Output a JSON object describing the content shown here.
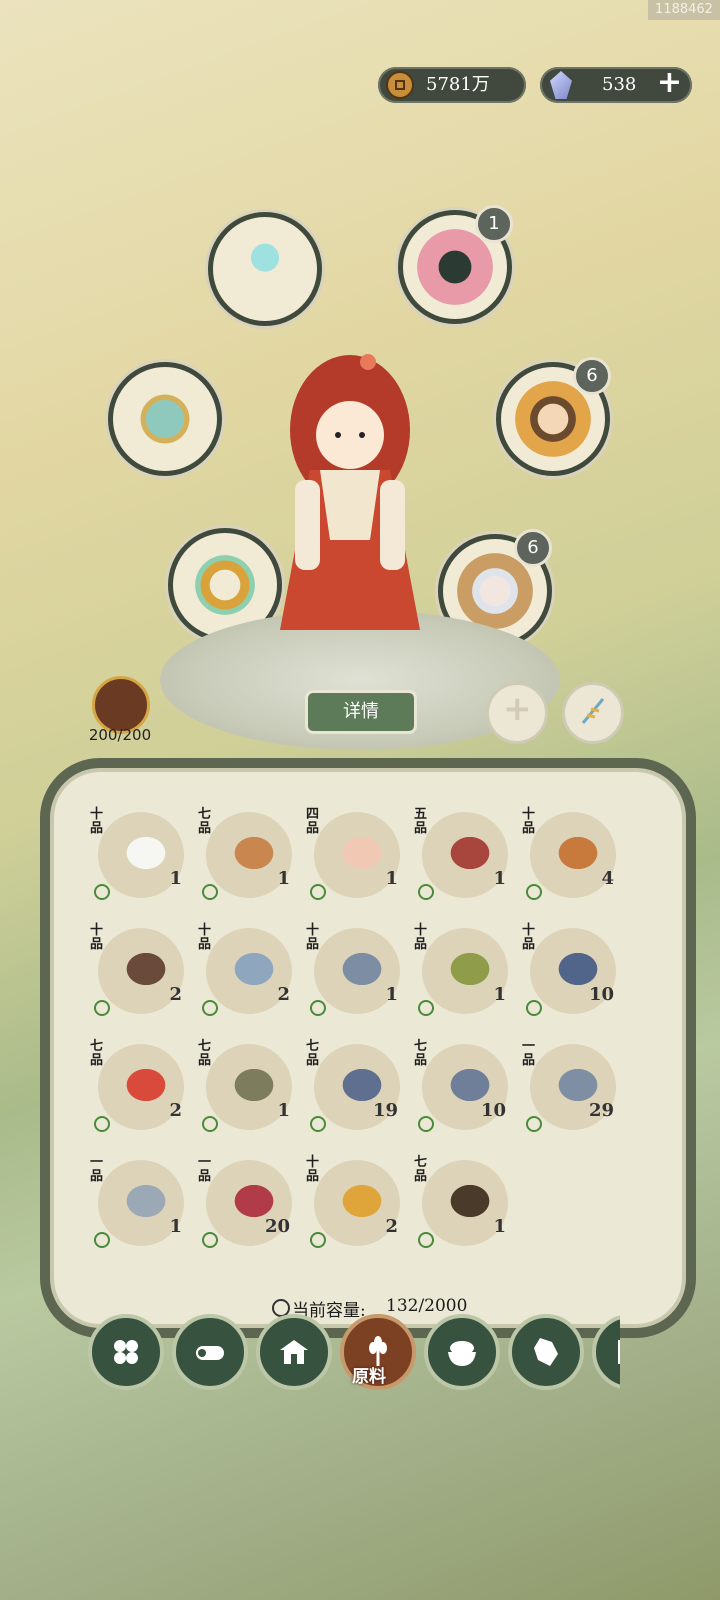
{
  "user_id": "1188462",
  "currency": {
    "coins": "5781万",
    "gems": "538",
    "add": "+"
  },
  "equipment": {
    "lotus_lamp": {},
    "dragon_pet": {
      "badge": "1"
    },
    "armor": {},
    "hero_a": {
      "badge": "6"
    },
    "ring": {},
    "hero_b": {
      "badge": "6"
    }
  },
  "stamina": "200/200",
  "detail_button": "详情",
  "add_button": "+",
  "inventory": {
    "items": [
      {
        "grade": "十品",
        "item": "radish",
        "count": "1"
      },
      {
        "grade": "七品",
        "item": "drumstick",
        "count": "1"
      },
      {
        "grade": "四品",
        "item": "chicken",
        "count": "1"
      },
      {
        "grade": "五品",
        "item": "meat",
        "count": "1"
      },
      {
        "grade": "十品",
        "item": "lobster",
        "count": "4"
      },
      {
        "grade": "十品",
        "item": "sea-cucumber",
        "count": "2"
      },
      {
        "grade": "十品",
        "item": "sardine",
        "count": "2"
      },
      {
        "grade": "十品",
        "item": "flying-fish",
        "count": "1"
      },
      {
        "grade": "十品",
        "item": "pike",
        "count": "1"
      },
      {
        "grade": "十品",
        "item": "swordfish",
        "count": "10"
      },
      {
        "grade": "七品",
        "item": "scorpionfish",
        "count": "2"
      },
      {
        "grade": "七品",
        "item": "gar",
        "count": "1"
      },
      {
        "grade": "七品",
        "item": "whale-shark",
        "count": "19"
      },
      {
        "grade": "七品",
        "item": "shark",
        "count": "10"
      },
      {
        "grade": "一品",
        "item": "mackerel",
        "count": "29"
      },
      {
        "grade": "一品",
        "item": "needlefish",
        "count": "1"
      },
      {
        "grade": "一品",
        "item": "dragon",
        "count": "20"
      },
      {
        "grade": "十品",
        "item": "butterfly",
        "count": "2"
      },
      {
        "grade": "七品",
        "item": "dung-beetle",
        "count": "1"
      }
    ],
    "capacity_label": "当前容量:",
    "capacity_value": "132/2000"
  },
  "bottom_nav": {
    "active_label": "原料",
    "tabs": [
      "menu",
      "wood",
      "house",
      "ingredients",
      "rice-bowl",
      "map",
      "book"
    ]
  },
  "colors": {
    "panel_border": "#5c6650",
    "nav_bg": "#37533f",
    "nav_active": "#7c4023",
    "detail_btn": "#5e7b59"
  }
}
